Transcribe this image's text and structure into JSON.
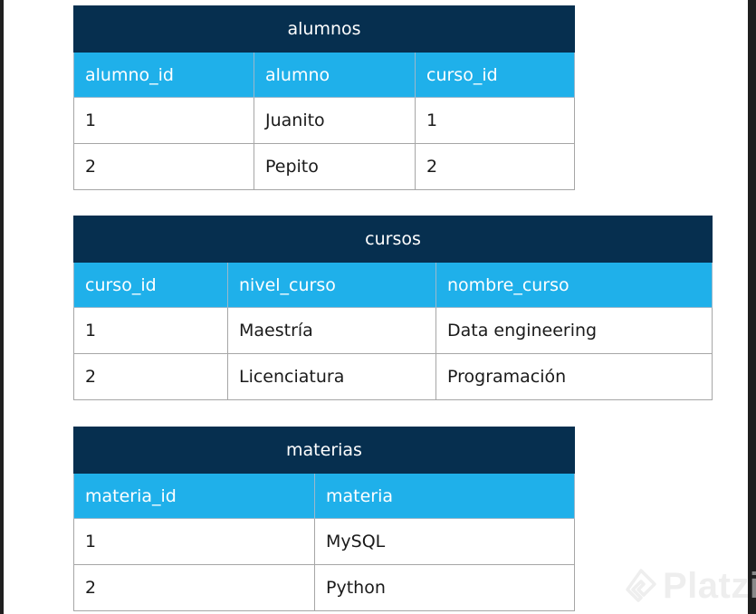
{
  "tables": [
    {
      "title": "alumnos",
      "columns": [
        "alumno_id",
        "alumno",
        "curso_id"
      ],
      "rows": [
        [
          "1",
          "Juanito",
          "1"
        ],
        [
          "2",
          "Pepito",
          "2"
        ]
      ]
    },
    {
      "title": "cursos",
      "columns": [
        "curso_id",
        "nivel_curso",
        "nombre_curso"
      ],
      "rows": [
        [
          "1",
          "Maestría",
          "Data engineering"
        ],
        [
          "2",
          "Licenciatura",
          "Programación"
        ]
      ]
    },
    {
      "title": "materias",
      "columns": [
        "materia_id",
        "materia"
      ],
      "rows": [
        [
          "1",
          "MySQL"
        ],
        [
          "2",
          "Python"
        ]
      ]
    }
  ],
  "watermark": {
    "text": "Platzi",
    "icon": "platzi-logo-icon"
  }
}
